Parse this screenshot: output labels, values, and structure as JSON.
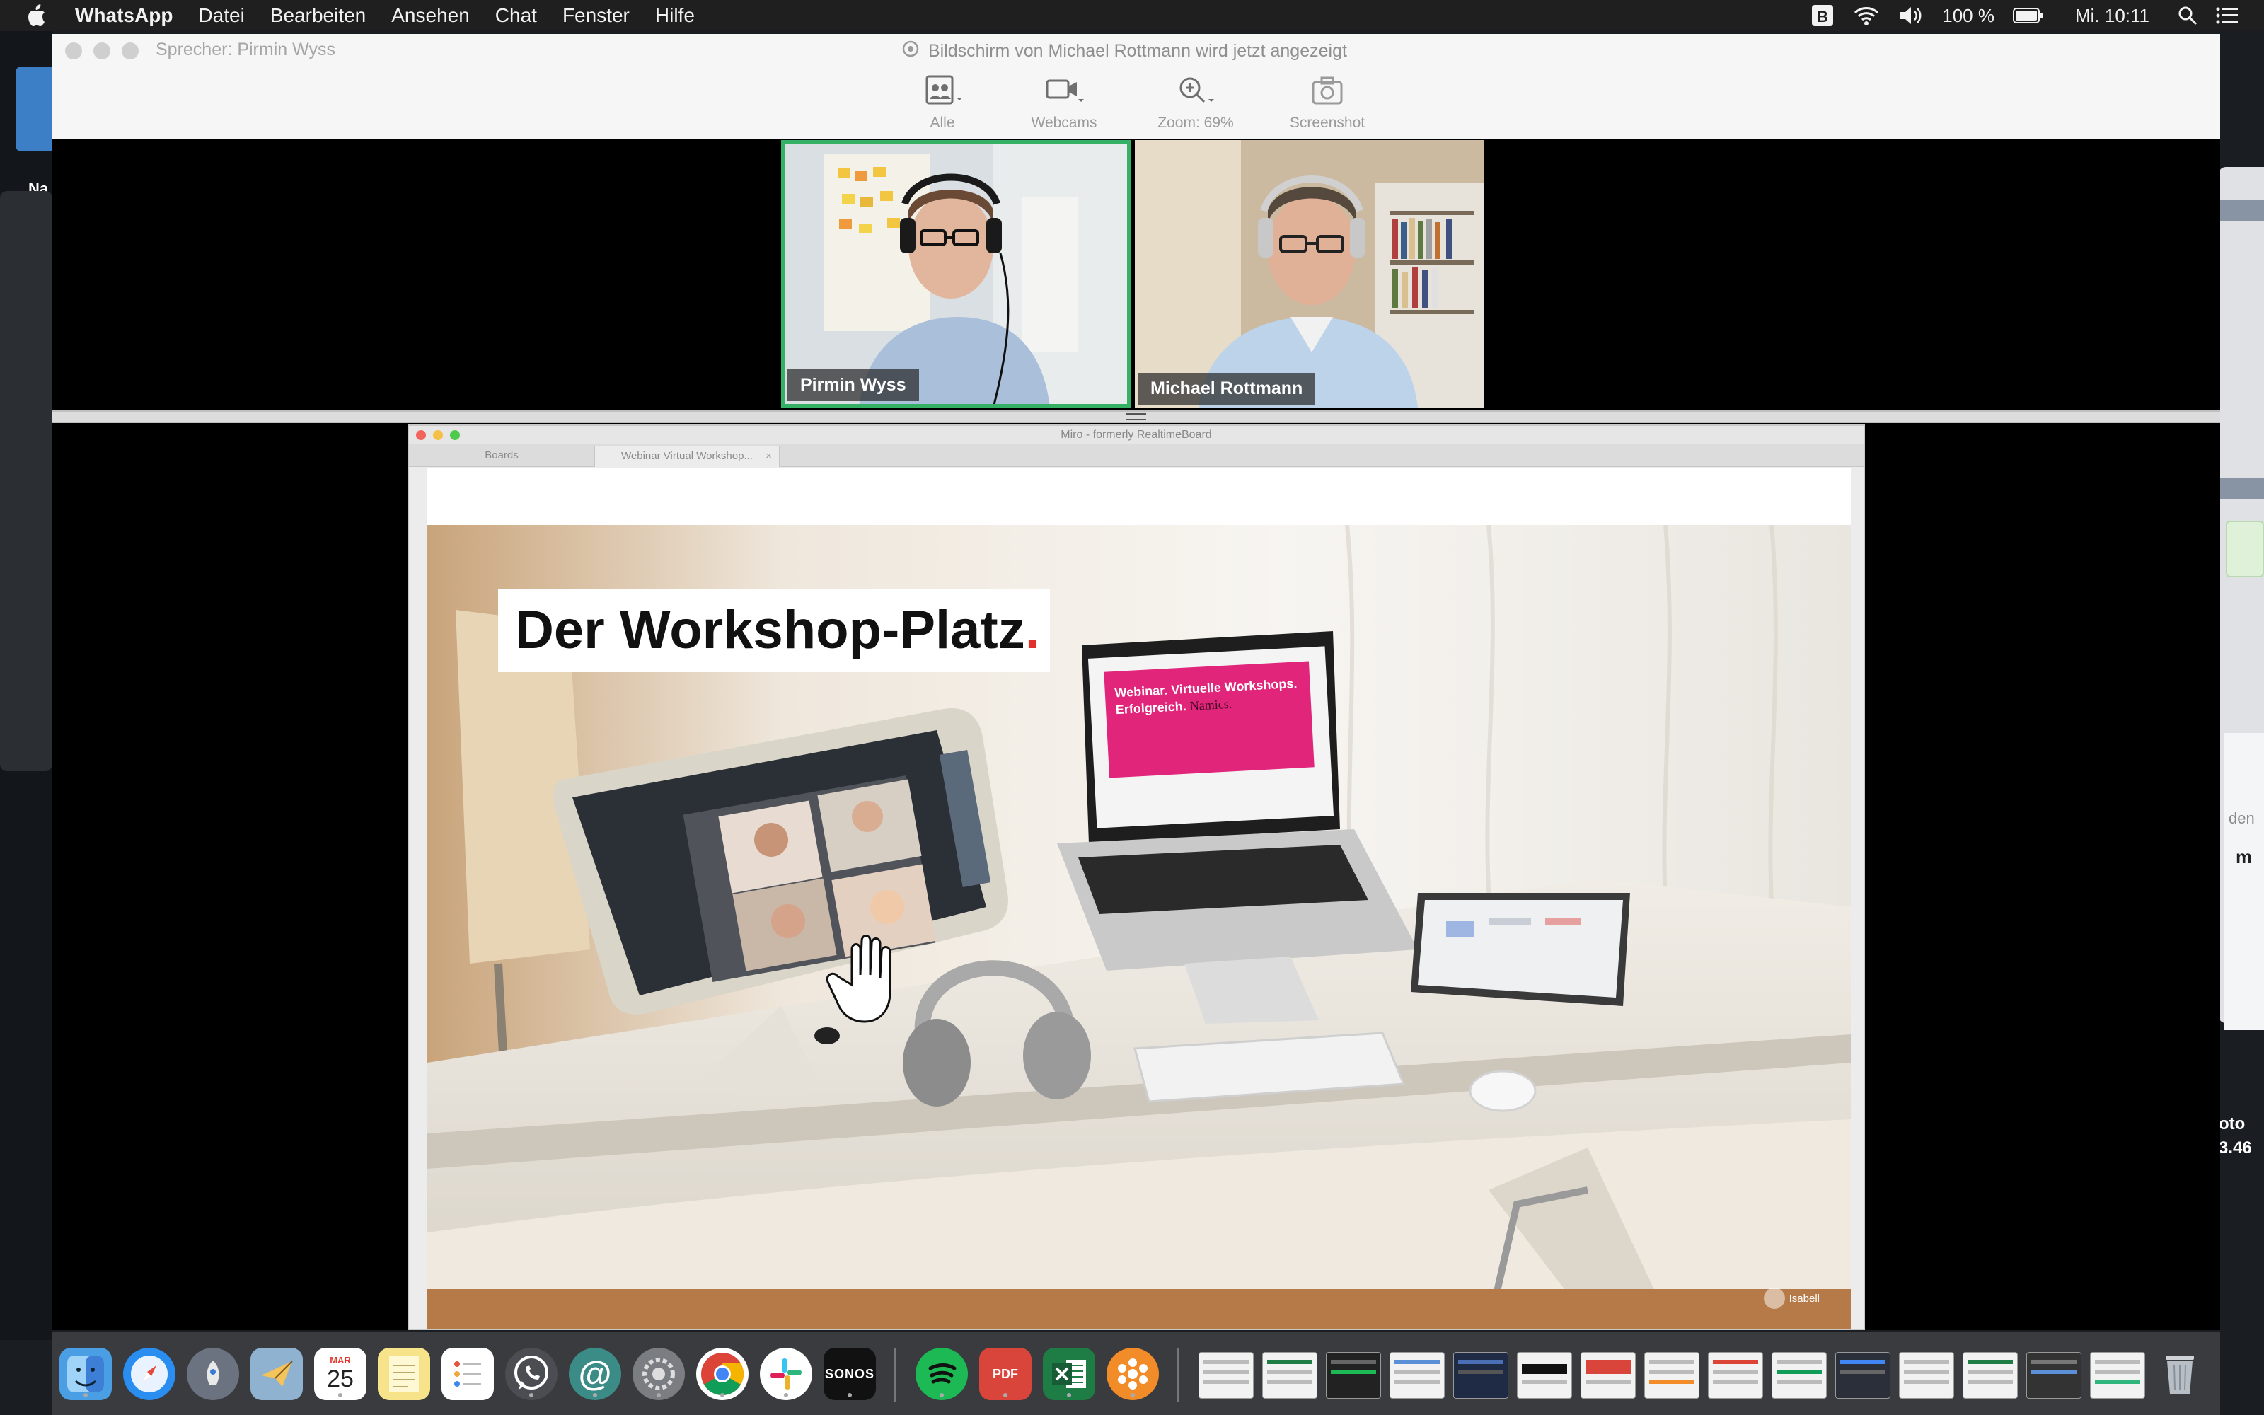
{
  "menubar": {
    "app_name": "WhatsApp",
    "items": [
      "Datei",
      "Bearbeiten",
      "Ansehen",
      "Chat",
      "Fenster",
      "Hilfe"
    ],
    "battery": "100 %",
    "clock": "Mi. 10:11"
  },
  "zoom": {
    "speaker_label": "Sprecher: Pirmin Wyss",
    "sharing_notice": "Bildschirm von Michael Rottmann wird jetzt angezeigt",
    "toolbar": {
      "all_label": "Alle",
      "webcams_label": "Webcams",
      "zoom_label": "Zoom: 69%",
      "screenshot_label": "Screenshot"
    },
    "participants": [
      {
        "name": "Pirmin Wyss",
        "active": true
      },
      {
        "name": "Michael Rottmann",
        "active": false
      }
    ]
  },
  "shared_screen": {
    "window_title": "Miro - formerly RealtimeBoard",
    "tabs": [
      {
        "label": "Boards"
      },
      {
        "label": "Webinar Virtual Workshop..."
      }
    ],
    "board_title": "Der Workshop-Platz",
    "board_title_dot": ".",
    "laptop_slide": {
      "line1": "Webinar. Virtuelle Workshops.",
      "line2": "Erfolgreich.",
      "brand": "Namics."
    },
    "cursor_user": "Isabell"
  },
  "desktop": {
    "left_label": "Na",
    "right_label_1": "den",
    "right_label_2": "m",
    "right_label_3": "oto",
    "right_label_4": "3.46"
  },
  "dock": {
    "calendar_month": "MAR",
    "calendar_day": "25",
    "sonos_label": "SONOS",
    "pdf_label": "PDF"
  },
  "colors": {
    "active_speaker_border": "#35b165",
    "miro_slide_pink": "#e0257a",
    "title_dot": "#e0312c"
  }
}
